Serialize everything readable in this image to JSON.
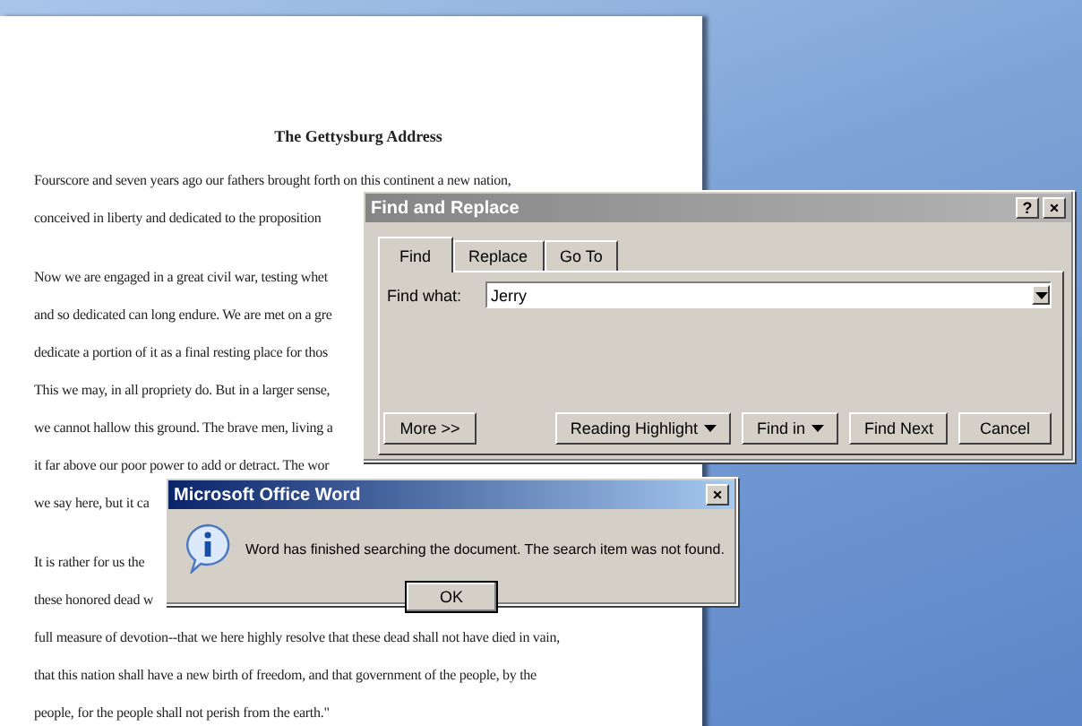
{
  "document": {
    "title": "The Gettysburg Address",
    "paragraphs": [
      [
        "Fourscore and seven years ago our fathers brought forth on this continent a new nation,",
        "conceived in liberty and dedicated to the proposition"
      ],
      [
        "Now we are engaged in a great civil war, testing whet",
        "and so dedicated can long endure. We are met on a gre",
        "dedicate a portion of it as a final resting place for thos",
        "This we may, in all propriety do. But in a larger sense,",
        "we cannot hallow this ground. The brave men, living a",
        "it far above our poor power to add or detract. The wor",
        "we say here, but it ca"
      ],
      [
        "It is rather for us the",
        "these honored dead w",
        "full measure of devotion--that we here highly resolve that these dead shall not have died in vain,",
        "that this nation shall have a new birth of freedom, and that government of the people, by the",
        "people, for the people shall not perish from the earth.\""
      ]
    ]
  },
  "find_dialog": {
    "title": "Find and Replace",
    "help_button": "?",
    "close_button": "×",
    "tabs": [
      {
        "label": "Find",
        "selected": true
      },
      {
        "label": "Replace",
        "selected": false
      },
      {
        "label": "Go To",
        "selected": false
      }
    ],
    "find_label": "Find what:",
    "find_value": "Jerry",
    "buttons": [
      {
        "label": "More >>",
        "menu": false
      },
      {
        "label": "Reading Highlight",
        "menu": true
      },
      {
        "label": "Find in",
        "menu": true
      },
      {
        "label": "Find Next",
        "menu": false
      },
      {
        "label": "Cancel",
        "menu": false
      }
    ]
  },
  "message_box": {
    "title": "Microsoft Office Word",
    "close_button": "×",
    "message": "Word has finished searching the document. The search item was not found.",
    "ok_button": "OK"
  }
}
